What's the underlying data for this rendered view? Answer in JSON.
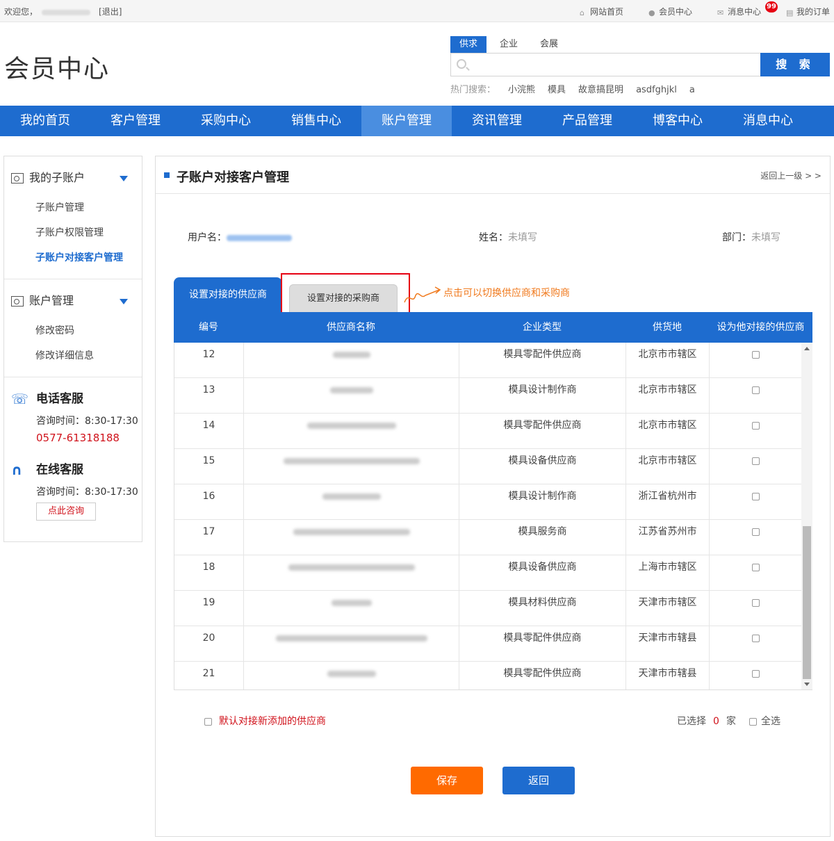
{
  "topbar": {
    "welcome": "欢迎您，",
    "logout": "[退出]",
    "links": [
      "网站首页",
      "会员中心",
      "消息中心",
      "我的订单"
    ],
    "msg_badge": "99"
  },
  "header": {
    "logo": "会员中心",
    "search_tabs": [
      "供求",
      "企业",
      "会展"
    ],
    "search_button": "搜 索",
    "hot_label": "热门搜索：",
    "hot_words": [
      "小浣熊",
      "模具",
      "故意搞昆明",
      "asdfghjkl",
      "a"
    ]
  },
  "nav": [
    "我的首页",
    "客户管理",
    "采购中心",
    "销售中心",
    "账户管理",
    "资讯管理",
    "产品管理",
    "博客中心",
    "消息中心"
  ],
  "sidebar": {
    "group1": {
      "title": "我的子账户",
      "items": [
        "子账户管理",
        "子账户权限管理",
        "子账户对接客户管理"
      ]
    },
    "group2": {
      "title": "账户管理",
      "items": [
        "修改密码",
        "修改详细信息"
      ]
    },
    "phone": {
      "title": "电话客服",
      "hours": "咨询时间：8:30-17:30",
      "number": "0577-61318188"
    },
    "online": {
      "title": "在线客服",
      "hours": "咨询时间：8:30-17:30",
      "button": "点此咨询"
    }
  },
  "main": {
    "title": "子账户对接客户管理",
    "back": "返回上一级 > >",
    "username_label": "用户名：",
    "name_label": "姓名：",
    "name_value": "未填写",
    "dept_label": "部门：",
    "dept_value": "未填写",
    "tab_supplier": "设置对接的供应商",
    "tab_buyer": "设置对接的采购商",
    "annotation": "点击可以切换供应商和采购商",
    "columns": [
      "编号",
      "供应商名称",
      "企业类型",
      "供货地",
      "设为他对接的供应商"
    ],
    "rows": [
      {
        "id": "12",
        "type": "模具零配件供应商",
        "place": "北京市市辖区"
      },
      {
        "id": "13",
        "type": "模具设计制作商",
        "place": "北京市市辖区"
      },
      {
        "id": "14",
        "type": "模具零配件供应商",
        "place": "北京市市辖区"
      },
      {
        "id": "15",
        "type": "模具设备供应商",
        "place": "北京市市辖区"
      },
      {
        "id": "16",
        "type": "模具设计制作商",
        "place": "浙江省杭州市"
      },
      {
        "id": "17",
        "type": "模具服务商",
        "place": "江苏省苏州市"
      },
      {
        "id": "18",
        "type": "模具设备供应商",
        "place": "上海市市辖区"
      },
      {
        "id": "19",
        "type": "模具材料供应商",
        "place": "天津市市辖区"
      },
      {
        "id": "20",
        "type": "模具零配件供应商",
        "place": "天津市市辖县"
      },
      {
        "id": "21",
        "type": "模具零配件供应商",
        "place": "天津市市辖县"
      }
    ],
    "default_label": "默认对接新添加的供应商",
    "selected_label": "已选择",
    "selected_count": "0",
    "selected_unit": "家",
    "select_all": "全选",
    "save": "保存",
    "return": "返回"
  },
  "colors": {
    "primary": "#1e6ccf",
    "orange": "#ff6a00",
    "red": "#e60012"
  }
}
